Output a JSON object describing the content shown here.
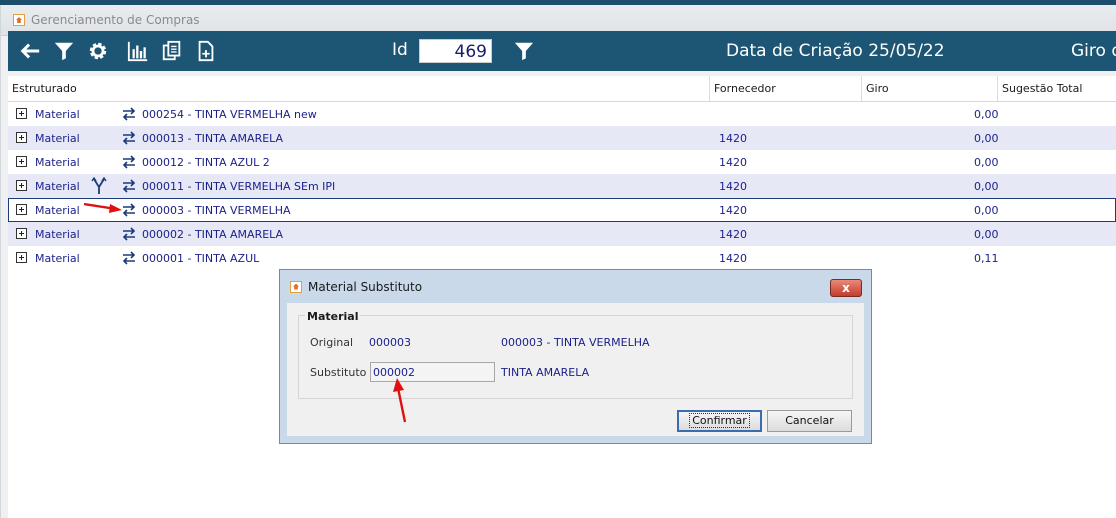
{
  "window": {
    "title": "Gerenciamento de Compras"
  },
  "toolbar": {
    "id_label": "Id",
    "id_value": "469",
    "date_label": "Data de Criação 25/05/22",
    "giro_label": "Giro d"
  },
  "grid": {
    "columns": [
      "Estruturado",
      "Fornecedor",
      "Giro",
      "Sugestão Total"
    ],
    "rows": [
      {
        "type": "Material",
        "desc": "000254 - TINTA VERMELHA new",
        "forn": "",
        "giro": "0,00"
      },
      {
        "type": "Material",
        "desc": "000013 - TINTA AMARELA",
        "forn": "1420",
        "giro": "0,00"
      },
      {
        "type": "Material",
        "desc": "000012 - TINTA AZUL 2",
        "forn": "1420",
        "giro": "0,00"
      },
      {
        "type": "Material",
        "desc": "000011 - TINTA VERMELHA SEm IPI",
        "forn": "1420",
        "giro": "0,00"
      },
      {
        "type": "Material",
        "desc": "000003 - TINTA VERMELHA",
        "forn": "1420",
        "giro": "0,00"
      },
      {
        "type": "Material",
        "desc": "000002 - TINTA AMARELA",
        "forn": "1420",
        "giro": "0,00"
      },
      {
        "type": "Material",
        "desc": "000001 - TINTA AZUL",
        "forn": "1420",
        "giro": "0,11"
      }
    ]
  },
  "dialog": {
    "title": "Material Substituto",
    "close_label": "x",
    "group_label": "Material",
    "original_label": "Original",
    "original_code": "000003",
    "original_desc": "000003 - TINTA VERMELHA",
    "substitute_label": "Substituto",
    "substitute_code": "000002",
    "substitute_desc": "TINTA AMARELA",
    "confirm_label": "Confirmar",
    "cancel_label": "Cancelar"
  },
  "colors": {
    "toolbar_bg": "#1d5574",
    "row_text": "#1a1f8a",
    "alt_row": "#e6e8f5",
    "annotation_arrow": "#e01010"
  }
}
